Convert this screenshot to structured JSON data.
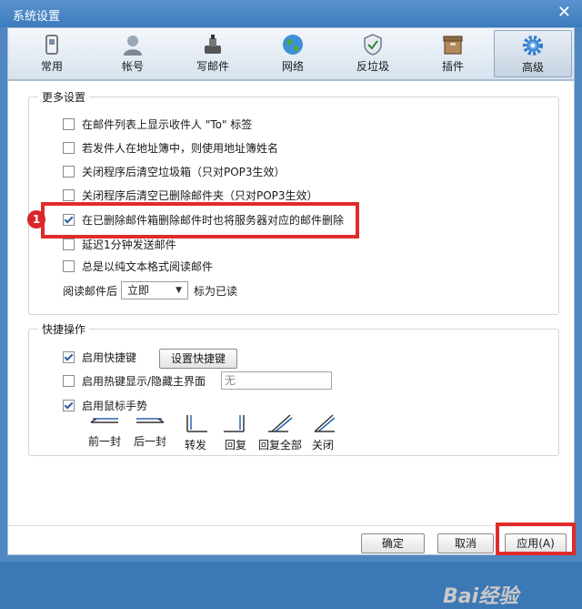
{
  "window": {
    "title": "系统设置",
    "close_symbol": "✕"
  },
  "tabs": [
    {
      "label": "常用",
      "icon": "phone-icon"
    },
    {
      "label": "帐号",
      "icon": "user-icon"
    },
    {
      "label": "写邮件",
      "icon": "ink-icon"
    },
    {
      "label": "网络",
      "icon": "globe-icon"
    },
    {
      "label": "反垃圾",
      "icon": "shield-icon"
    },
    {
      "label": "插件",
      "icon": "box-icon"
    },
    {
      "label": "高级",
      "icon": "gear-icon",
      "active": true
    }
  ],
  "more_settings": {
    "title": "更多设置",
    "options": [
      {
        "label": "在邮件列表上显示收件人 \"To\" 标签",
        "checked": false
      },
      {
        "label": "若发件人在地址簿中，则使用地址簿姓名",
        "checked": false
      },
      {
        "label": "关闭程序后清空垃圾箱（只对POP3生效）",
        "checked": false
      },
      {
        "label": "关闭程序后清空已删除邮件夹（只对POP3生效）",
        "checked": false
      },
      {
        "label": "在已删除邮件箱删除邮件时也将服务器对应的邮件删除",
        "checked": true
      },
      {
        "label": "延迟1分钟发送邮件",
        "checked": false
      },
      {
        "label": "总是以纯文本格式阅读邮件",
        "checked": false
      }
    ],
    "read_mail": {
      "prefix": "阅读邮件后",
      "value": "立即",
      "suffix": "标为已读"
    }
  },
  "shortcuts": {
    "title": "快捷操作",
    "enable_hotkeys": {
      "label": "启用快捷键",
      "checked": true
    },
    "set_hotkeys_button": "设置快捷键",
    "hotkey_toggle_main": {
      "label": "启用热键显示/隐藏主界面",
      "checked": false,
      "value": "无"
    },
    "enable_gestures": {
      "label": "启用鼠标手势",
      "checked": true
    },
    "gestures": [
      "前一封",
      "后一封",
      "转发",
      "回复",
      "回复全部",
      "关闭"
    ]
  },
  "footer": {
    "ok": "确定",
    "cancel": "取消",
    "apply": "应用(A)"
  },
  "annotation": {
    "badge": "1"
  },
  "watermark": "Bai经验",
  "colors": {
    "accent": "#2a5ea8",
    "highlight": "#e02b2b",
    "titlebar": "#3c7bbd"
  }
}
